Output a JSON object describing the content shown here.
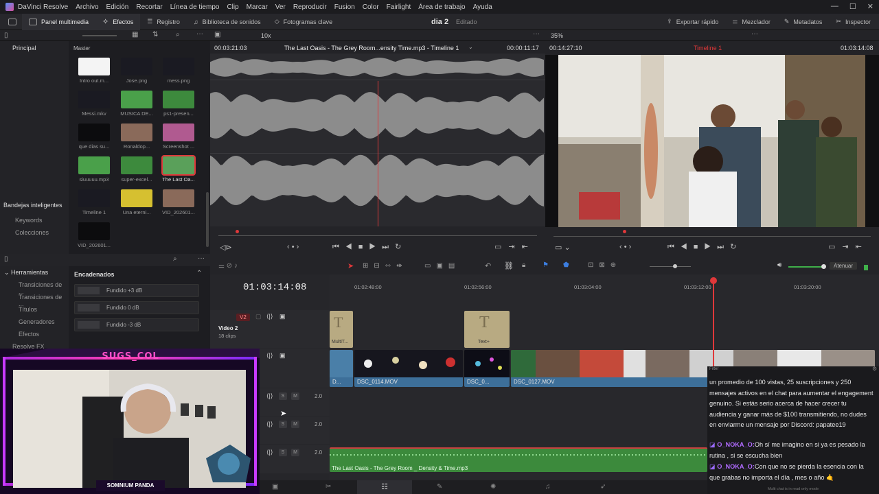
{
  "menubar": {
    "app_name": "DaVinci Resolve",
    "items": [
      "Archivo",
      "Edición",
      "Recortar",
      "Línea de tiempo",
      "Clip",
      "Marcar",
      "Ver",
      "Reproducir",
      "Fusion",
      "Color",
      "Fairlight",
      "Área de trabajo",
      "Ayuda"
    ]
  },
  "toolbar": {
    "media_pool": "Panel multimedia",
    "effects": "Efectos",
    "edit_index": "Registro",
    "sound_library": "Biblioteca de sonidos",
    "keyframes": "Fotogramas clave",
    "project_name": "dia 2",
    "project_status": "Editado",
    "quick_export": "Exportar rápido",
    "mixer": "Mezclador",
    "metadata": "Metadatos",
    "inspector": "Inspector"
  },
  "subbar": {
    "zoom_left": "10x",
    "zoom_right": "35%"
  },
  "bins": {
    "main_label": "Principal",
    "master_label": "Master",
    "smart_bins": "Bandejas inteligentes",
    "keywords": "Keywords",
    "collections": "Colecciones"
  },
  "media": [
    {
      "label": "Intro out.m...",
      "kind": "white"
    },
    {
      "label": "Jose.png",
      "kind": "dark"
    },
    {
      "label": "mess.png",
      "kind": "dark"
    },
    {
      "label": "Messi.mkv",
      "kind": "dark"
    },
    {
      "label": "MUSICA DE...",
      "kind": "green"
    },
    {
      "label": "ps1-presen...",
      "kind": "green2"
    },
    {
      "label": "que dias su...",
      "kind": "black"
    },
    {
      "label": "Ronaldop...",
      "kind": "photo"
    },
    {
      "label": "Screenshot ...",
      "kind": "pink"
    },
    {
      "label": "siuuuuu.mp3",
      "kind": "green"
    },
    {
      "label": "super-excel...",
      "kind": "green2"
    },
    {
      "label": "The Last Oa...",
      "kind": "selected"
    },
    {
      "label": "Timeline 1",
      "kind": "dark"
    },
    {
      "label": "Una eterni...",
      "kind": "yellow"
    },
    {
      "label": "VID_202601...",
      "kind": "photo"
    },
    {
      "label": "VID_202601...",
      "kind": "black"
    }
  ],
  "source_viewer": {
    "timecode_in": "00:03:21:03",
    "title": "The Last Oasis - The Grey Room...ensity  Time.mp3 - Timeline 1",
    "duration": "00:00:11:17"
  },
  "program_viewer": {
    "timecode_left": "00:14:27:10",
    "timeline_name": "Timeline 1",
    "timecode_right": "01:03:14:08"
  },
  "effects_panel": {
    "tools_title": "Herramientas",
    "items": [
      "Transiciones de ...",
      "Transiciones de ...",
      "Títulos",
      "Generadores",
      "Efectos",
      "Resolve FX"
    ],
    "chained_title": "Encadenados",
    "presets": [
      "Fundido +3 dB",
      "Fundido 0 dB",
      "Fundido -3 dB"
    ]
  },
  "timeline": {
    "current_timecode": "01:03:14:08",
    "ruler": [
      "01:02:48:00",
      "01:02:56:00",
      "01:03:04:00",
      "01:03:12:00",
      "01:03:20:00"
    ],
    "track_v2": "V2",
    "track_v2_name": "Video 2",
    "track_v2_clips": "18 clips",
    "text_clip1": "MultiT...",
    "text_clip2": "Text+",
    "video_clips": [
      "D...",
      "DSC_0114.MOV",
      "DSC_0...",
      "DSC_0127.MOV"
    ],
    "audio_levels": [
      "2.0",
      "2.0",
      "2.0"
    ],
    "audio_clip": "The Last Oasis - The Grey Room _ Density & Time.mp3",
    "mute_label": "Atenuar",
    "s_label": "S",
    "m_label": "M"
  },
  "stream_overlay": {
    "channel_name": "SUGS_COL",
    "badge_name": "SOMNIUM PANDA"
  },
  "chat": {
    "filter": "Filter",
    "messages": [
      {
        "user": "",
        "text": "un promedio de 100 vistas, 25 suscripciones y 250 mensajes activos en el chat para aumentar el engagement genuino. Si estás serio acerca de hacer crecer tu audiencia y ganar más de $100 transmitiendo, no dudes en enviarme un mensaje por Discord: papatee19"
      },
      {
        "user": "O_NOKA_O:",
        "text": "Oh sí me imagino en si ya es pesado la rutina , si se escucha bien"
      },
      {
        "user": "O_NOKA_O:",
        "text": "Con que no se pierda la esencia con la que grabas no importa el día , mes o año 🤙"
      }
    ],
    "footer": "Multi chat is in read only mode"
  },
  "colors": {
    "accent_red": "#e0383a",
    "clip_blue": "#3d6f99",
    "audio_green": "#4a9a4a",
    "text_clip": "#b8aa82"
  }
}
